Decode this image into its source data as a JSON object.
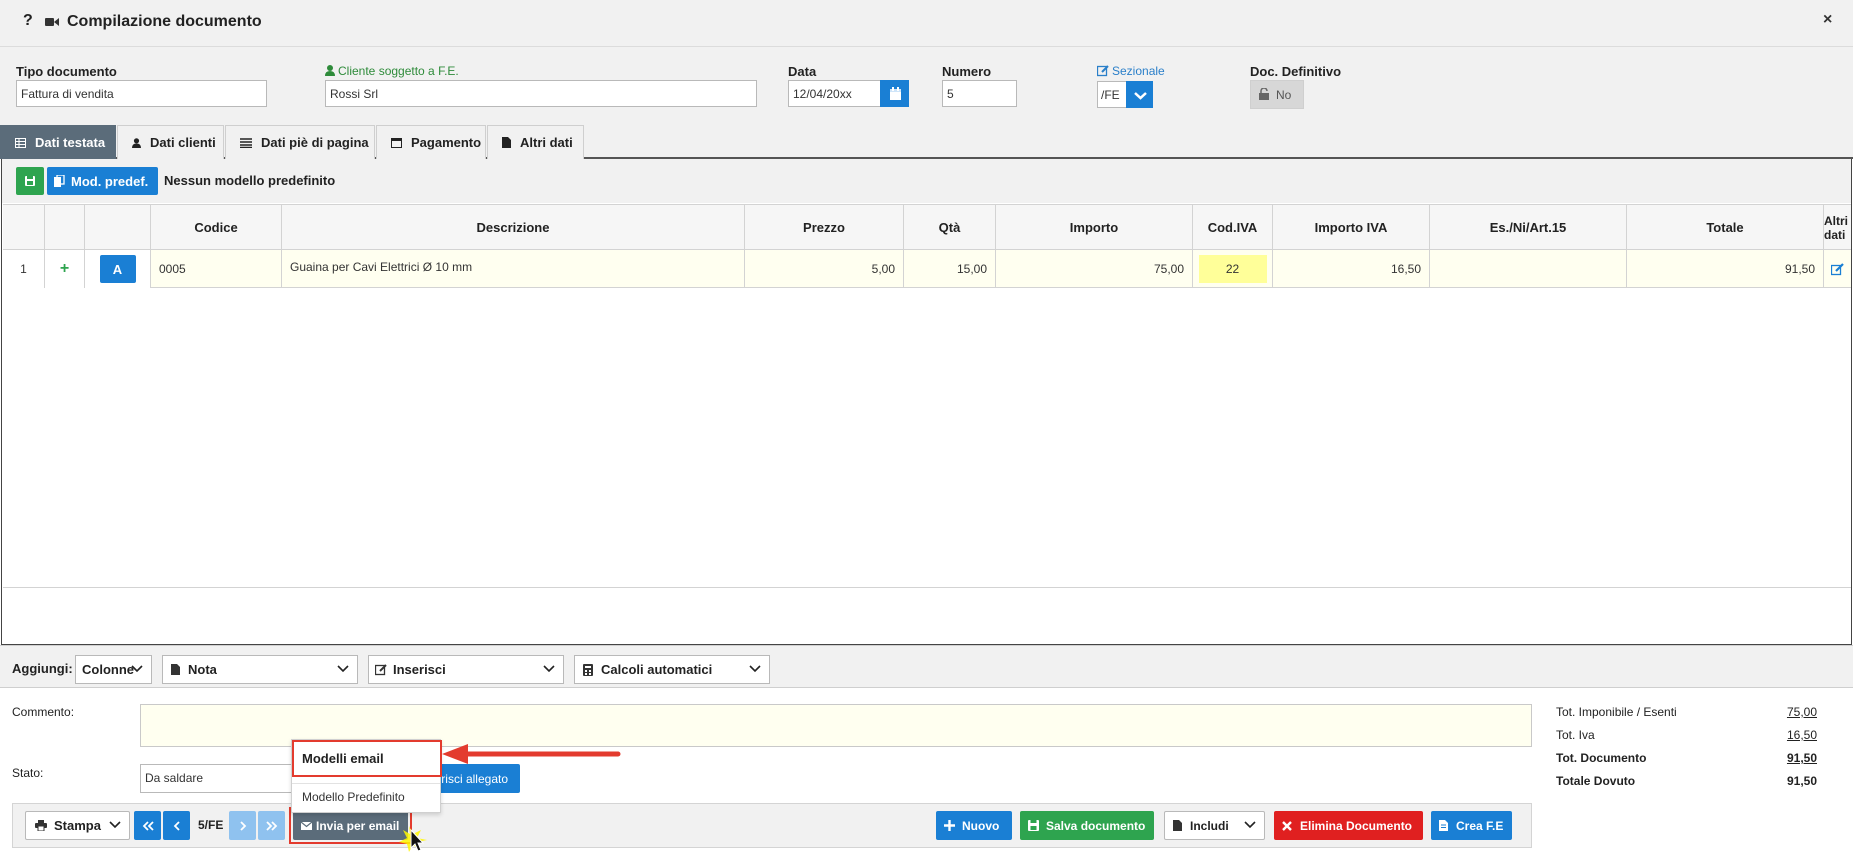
{
  "window": {
    "help_glyph": "?",
    "title": "Compilazione documento",
    "close_glyph": "×"
  },
  "form": {
    "tipo_documento": {
      "label": "Tipo documento",
      "value": "Fattura di vendita"
    },
    "cliente": {
      "label": "Cliente soggetto a F.E.",
      "value": "Rossi Srl"
    },
    "data": {
      "label": "Data",
      "value": "12/04/20xx"
    },
    "numero": {
      "label": "Numero",
      "value": "5"
    },
    "sezionale": {
      "label": "Sezionale",
      "value": "/FE"
    },
    "doc_definitivo": {
      "label": "Doc. Definitivo",
      "value": "No"
    }
  },
  "tabs": [
    {
      "label": "Dati testata",
      "icon": "table-icon",
      "active": true
    },
    {
      "label": "Dati clienti",
      "icon": "user-icon"
    },
    {
      "label": "Dati piè di pagina",
      "icon": "list-icon"
    },
    {
      "label": "Pagamento",
      "icon": "calendar-icon"
    },
    {
      "label": "Altri dati",
      "icon": "file-icon"
    }
  ],
  "toolbar": {
    "mod_predef_label": "Mod. predef.",
    "model_text": "Nessun modello predefinito"
  },
  "table": {
    "columns": [
      "",
      "",
      "",
      "Codice",
      "Descrizione",
      "Prezzo",
      "Qtà",
      "Importo",
      "Cod.IVA",
      "Importo IVA",
      "Es./Ni/Art.15",
      "Totale",
      "Altri dati"
    ],
    "rows": [
      {
        "num": "1",
        "add": "+",
        "type": "A",
        "codice": "0005",
        "descrizione": "Guaina per Cavi Elettrici Ø 10 mm",
        "prezzo": "5,00",
        "qta": "15,00",
        "importo": "75,00",
        "cod_iva": "22",
        "importo_iva": "16,50",
        "esenzione": "",
        "totale": "91,50"
      }
    ]
  },
  "addbar": {
    "label": "Aggiungi:",
    "colonne": "Colonne",
    "nota": "Nota",
    "inserisci": "Inserisci",
    "calcoli": "Calcoli automatici"
  },
  "bottom": {
    "commento_label": "Commento:",
    "stato_label": "Stato:",
    "stato_value": "Da saldare",
    "inserisci_allegato": "risci allegato"
  },
  "totals": [
    {
      "label": "Tot. Imponibile / Esenti",
      "value": "75,00",
      "bold": false
    },
    {
      "label": "Tot. Iva",
      "value": "16,50",
      "bold": false
    },
    {
      "label": "Tot. Documento",
      "value": "91,50",
      "bold": true
    },
    {
      "label": "Totale Dovuto",
      "value": "91,50",
      "bold": true
    }
  ],
  "actions": {
    "stampa": "Stampa",
    "page_indicator": "5/FE",
    "invia_email": "Invia per email",
    "nuovo": "Nuovo",
    "salva": "Salva documento",
    "includi": "Includi",
    "elimina": "Elimina Documento",
    "crea_fe": "Crea F.E"
  },
  "email_menu": {
    "header": "Modelli email",
    "items": [
      "Modello Predefinito"
    ]
  },
  "colors": {
    "primary_blue": "#1a7fd4",
    "green": "#2ea44f",
    "red": "#e02020",
    "tab_active": "#5b6c7a",
    "highlight_yellow": "#ffff99",
    "annotation_red": "#e33b2e"
  }
}
